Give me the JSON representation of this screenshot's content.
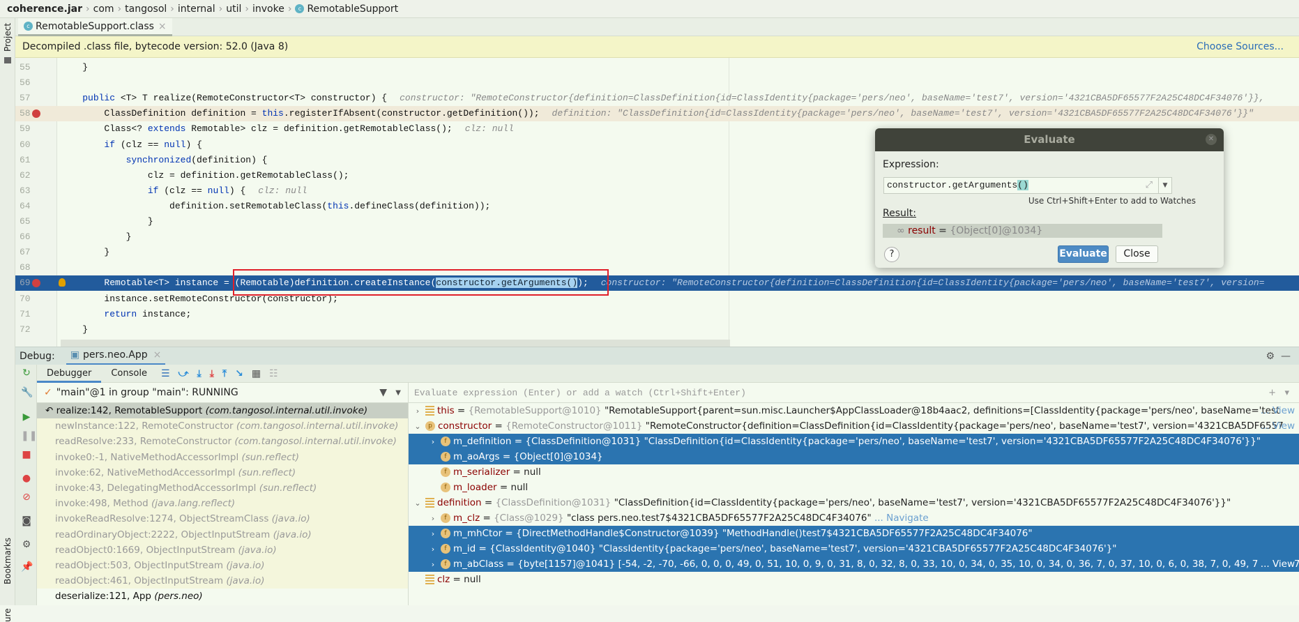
{
  "breadcrumb": [
    "coherence.jar",
    "com",
    "tangosol",
    "internal",
    "util",
    "invoke",
    "RemotableSupport"
  ],
  "sidebar": {
    "project": "Project",
    "bookmarks": "Bookmarks",
    "structure": "ure"
  },
  "editor_tab": {
    "label": "RemotableSupport.class",
    "close": "×"
  },
  "banner": {
    "text": "Decompiled .class file, bytecode version: 52.0 (Java 8)",
    "link": "Choose Sources..."
  },
  "code": [
    {
      "num": "55",
      "code": "    }"
    },
    {
      "num": "56",
      "code": ""
    },
    {
      "num": "57",
      "code": "    public <T> T realize(RemoteConstructor<T> constructor) {",
      "hint": "constructor: \"RemoteConstructor{definition=ClassDefinition{id=ClassIdentity{package='pers/neo', baseName='test7', version='4321CBA5DF65577F2A25C48DC4F34076'}},"
    },
    {
      "num": "58",
      "code": "        ClassDefinition definition = this.registerIfAbsent(constructor.getDefinition());",
      "hint": "definition: \"ClassDefinition{id=ClassIdentity{package='pers/neo', baseName='test7', version='4321CBA5DF65577F2A25C48DC4F34076'}}\"",
      "breakpoint": true
    },
    {
      "num": "59",
      "code": "        Class<? extends Remotable> clz = definition.getRemotableClass();",
      "hint": "clz: null"
    },
    {
      "num": "60",
      "code": "        if (clz == null) {"
    },
    {
      "num": "61",
      "code": "            synchronized(definition) {"
    },
    {
      "num": "62",
      "code": "                clz = definition.getRemotableClass();"
    },
    {
      "num": "63",
      "code": "                if (clz == null) {",
      "hint": "clz: null"
    },
    {
      "num": "64",
      "code": "                    definition.setRemotableClass(this.defineClass(definition));"
    },
    {
      "num": "65",
      "code": "                }"
    },
    {
      "num": "66",
      "code": "            }"
    },
    {
      "num": "67",
      "code": "        }"
    },
    {
      "num": "68",
      "code": ""
    },
    {
      "num": "69",
      "code": "        Remotable<T> instance = (Remotable)definition.createInstance(constructor.getArguments());",
      "hint": "constructor: \"RemoteConstructor{definition=ClassDefinition{id=ClassIdentity{package='pers/neo', baseName='test7', version=",
      "breakpoint": true,
      "current": true,
      "selection": "constructor.getArguments()"
    },
    {
      "num": "70",
      "code": "        instance.setRemoteConstructor(constructor);"
    },
    {
      "num": "71",
      "code": "        return instance;"
    },
    {
      "num": "72",
      "code": "    }"
    }
  ],
  "evaluate": {
    "title": "Evaluate",
    "expression_label": "Expression:",
    "expression": "constructor.getArguments",
    "expression_paren": "()",
    "watch_hint": "Use Ctrl+Shift+Enter to add to Watches",
    "result_label": "Result:",
    "result_name": "result",
    "result_eq": " = ",
    "result_value": "{Object[0]@1034}",
    "evaluate_button": "Evaluate",
    "close_button": "Close",
    "help": "?"
  },
  "debug": {
    "label": "Debug:",
    "session": "pers.neo.App",
    "tabs": [
      "Debugger",
      "Console"
    ],
    "thread": "\"main\"@1 in group \"main\": RUNNING",
    "watch_placeholder": "Evaluate expression (Enter) or add a watch (Ctrl+Shift+Enter)"
  },
  "frames": [
    {
      "m": "realize:142, RemotableSupport",
      "p": "(com.tangosol.internal.util.invoke)",
      "style": "current"
    },
    {
      "m": "newInstance:122, RemoteConstructor",
      "p": "(com.tangosol.internal.util.invoke)",
      "style": "lib"
    },
    {
      "m": "readResolve:233, RemoteConstructor",
      "p": "(com.tangosol.internal.util.invoke)",
      "style": "lib"
    },
    {
      "m": "invoke0:-1, NativeMethodAccessorImpl",
      "p": "(sun.reflect)",
      "style": "lib"
    },
    {
      "m": "invoke:62, NativeMethodAccessorImpl",
      "p": "(sun.reflect)",
      "style": "lib"
    },
    {
      "m": "invoke:43, DelegatingMethodAccessorImpl",
      "p": "(sun.reflect)",
      "style": "lib"
    },
    {
      "m": "invoke:498, Method",
      "p": "(java.lang.reflect)",
      "style": "lib"
    },
    {
      "m": "invokeReadResolve:1274, ObjectStreamClass",
      "p": "(java.io)",
      "style": "lib"
    },
    {
      "m": "readOrdinaryObject:2222, ObjectInputStream",
      "p": "(java.io)",
      "style": "lib"
    },
    {
      "m": "readObject0:1669, ObjectInputStream",
      "p": "(java.io)",
      "style": "lib"
    },
    {
      "m": "readObject:503, ObjectInputStream",
      "p": "(java.io)",
      "style": "lib"
    },
    {
      "m": "readObject:461, ObjectInputStream",
      "p": "(java.io)",
      "style": "lib"
    },
    {
      "m": "deserialize:121, App",
      "p": "(pers.neo)",
      "style": "app"
    }
  ],
  "variables": [
    {
      "level": 0,
      "arrow": ">",
      "icon": "local",
      "name": "this",
      "type": "{RemotableSupport@1010}",
      "value": "\"RemotableSupport{parent=sun.misc.Launcher$AppClassLoader@18b4aac2, definitions=[ClassIdentity{package='pers/neo', baseName='test",
      "link": "... View"
    },
    {
      "level": 0,
      "arrow": "v",
      "icon": "param",
      "name": "constructor",
      "type": "{RemoteConstructor@1011}",
      "value": "\"RemoteConstructor{definition=ClassDefinition{id=ClassIdentity{package='pers/neo', baseName='test7', version='4321CBA5DF6557",
      "link": "... View"
    },
    {
      "level": 1,
      "arrow": ">",
      "icon": "field",
      "name": "m_definition",
      "type": "{ClassDefinition@1031}",
      "value": "\"ClassDefinition{id=ClassIdentity{package='pers/neo', baseName='test7', version='4321CBA5DF65577F2A25C48DC4F34076'}}\"",
      "selected": true
    },
    {
      "level": 1,
      "arrow": "",
      "icon": "field",
      "name": "m_aoArgs",
      "type": "{Object[0]@1034}",
      "value": "",
      "selected": true
    },
    {
      "level": 1,
      "arrow": "",
      "icon": "field",
      "name": "m_serializer",
      "type": "",
      "value": "null"
    },
    {
      "level": 1,
      "arrow": "",
      "icon": "field",
      "name": "m_loader",
      "type": "",
      "value": "null"
    },
    {
      "level": 0,
      "arrow": "v",
      "icon": "local",
      "name": "definition",
      "type": "{ClassDefinition@1031}",
      "value": "\"ClassDefinition{id=ClassIdentity{package='pers/neo', baseName='test7', version='4321CBA5DF65577F2A25C48DC4F34076'}}\""
    },
    {
      "level": 1,
      "arrow": ">",
      "icon": "field",
      "name": "m_clz",
      "type": "{Class@1029}",
      "value": "\"class pers.neo.test7$4321CBA5DF65577F2A25C48DC4F34076\"",
      "nav": " ... Navigate"
    },
    {
      "level": 1,
      "arrow": ">",
      "icon": "field",
      "name": "m_mhCtor",
      "type": "{DirectMethodHandle$Constructor@1039}",
      "value": "\"MethodHandle()test7$4321CBA5DF65577F2A25C48DC4F34076\"",
      "selected": true
    },
    {
      "level": 1,
      "arrow": ">",
      "icon": "field",
      "name": "m_id",
      "type": "{ClassIdentity@1040}",
      "value": "\"ClassIdentity{package='pers/neo', baseName='test7', version='4321CBA5DF65577F2A25C48DC4F34076'}\"",
      "selected": true
    },
    {
      "level": 1,
      "arrow": ">",
      "icon": "field",
      "name": "m_abClass",
      "type": "{byte[1157]@1041}",
      "value": "[-54, -2, -70, -66, 0, 0, 0, 49, 0, 51, 10, 0, 9, 0, 31, 8, 0, 32, 8, 0, 33, 10, 0, 34, 0, 35, 10, 0, 34, 0, 36, 7, 0, 37, 10, 0, 6, 0, 38, 7, 0, 49, 7, 0, 40, 7, 0, 41, 7, 0, 4",
      "link": "... View",
      "selected": true
    },
    {
      "level": 0,
      "arrow": "",
      "icon": "local",
      "name": "clz",
      "type": "",
      "value": "null"
    }
  ],
  "colors": {
    "accent": "#4a88c7",
    "current_line": "#225b9c",
    "selection": "#2b74b0",
    "highlight_box": "#e0202a"
  }
}
